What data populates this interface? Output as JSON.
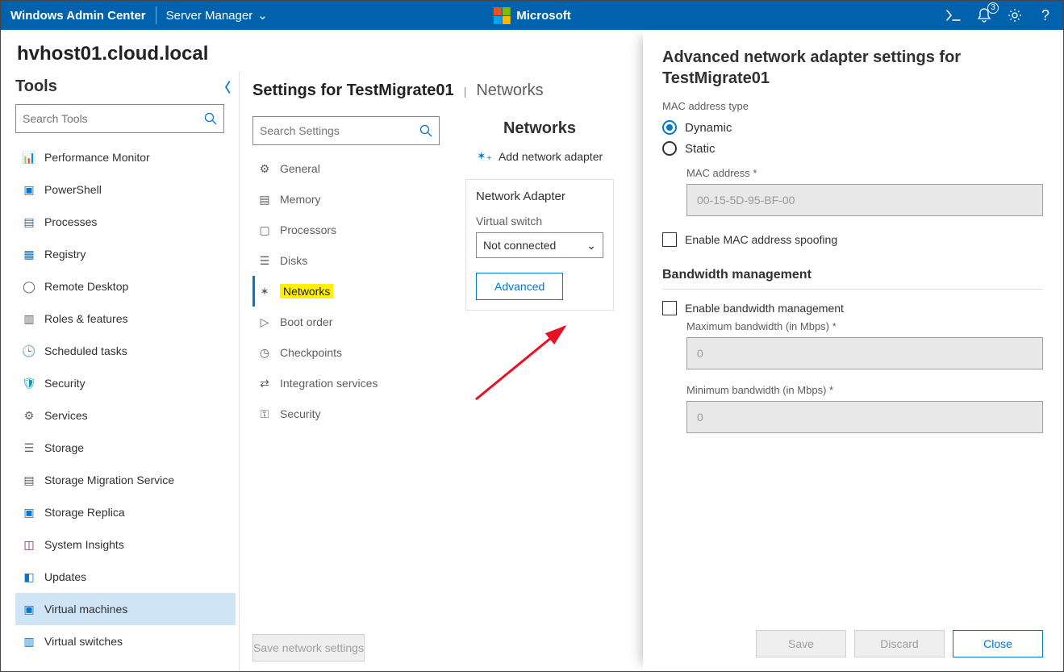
{
  "topbar": {
    "app": "Windows Admin Center",
    "picker": "Server Manager",
    "brand": "Microsoft",
    "notif_count": "3"
  },
  "host": "hvhost01.cloud.local",
  "tools": {
    "heading": "Tools",
    "search_placeholder": "Search Tools",
    "items": [
      "Performance Monitor",
      "PowerShell",
      "Processes",
      "Registry",
      "Remote Desktop",
      "Roles & features",
      "Scheduled tasks",
      "Security",
      "Services",
      "Storage",
      "Storage Migration Service",
      "Storage Replica",
      "System Insights",
      "Updates",
      "Virtual machines",
      "Virtual switches"
    ],
    "selected_index": 14
  },
  "settings": {
    "heading_prefix": "Settings for ",
    "vm_name": "TestMigrate01",
    "crumb": "Networks",
    "search_placeholder": "Search Settings",
    "items": [
      "General",
      "Memory",
      "Processors",
      "Disks",
      "Networks",
      "Boot order",
      "Checkpoints",
      "Integration services",
      "Security"
    ],
    "active_index": 4
  },
  "networks": {
    "title": "Networks",
    "add_label": "Add network adapter",
    "card_title": "Network Adapter",
    "switch_label": "Virtual switch",
    "switch_value": "Not connected",
    "advanced_btn": "Advanced",
    "save_btn": "Save network settings"
  },
  "panel": {
    "title_prefix": "Advanced network adapter settings for ",
    "vm_name": "TestMigrate01",
    "mac_type_label": "MAC address type",
    "radio_dynamic": "Dynamic",
    "radio_static": "Static",
    "mac_selected": "dynamic",
    "mac_field_label": "MAC address",
    "mac_value": "00-15-5D-95-BF-00",
    "spoof_label": "Enable MAC address spoofing",
    "bw_heading": "Bandwidth management",
    "bw_enable_label": "Enable bandwidth management",
    "bw_max_label": "Maximum bandwidth (in Mbps)",
    "bw_max_val": "0",
    "bw_min_label": "Minimum bandwidth (in Mbps)",
    "bw_min_val": "0",
    "save": "Save",
    "discard": "Discard",
    "close": "Close"
  }
}
